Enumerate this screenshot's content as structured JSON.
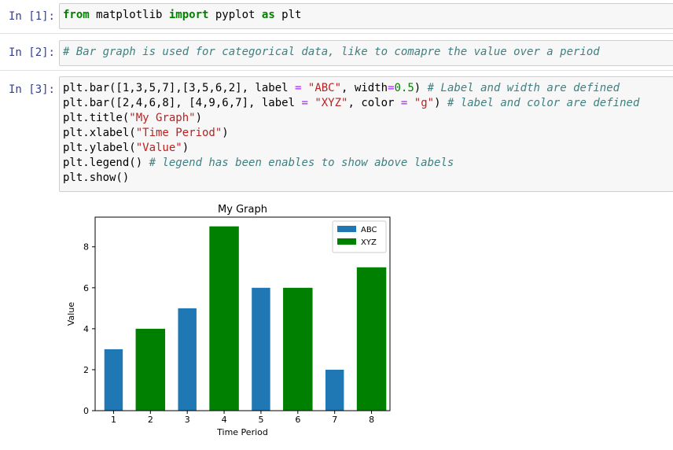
{
  "cells": [
    {
      "prompt": "In [1]:",
      "tokens": [
        [
          {
            "t": "from",
            "c": "kw"
          },
          {
            "t": " matplotlib ",
            "c": ""
          },
          {
            "t": "import",
            "c": "kw"
          },
          {
            "t": " pyplot ",
            "c": ""
          },
          {
            "t": "as",
            "c": "kw"
          },
          {
            "t": " plt",
            "c": ""
          }
        ]
      ]
    },
    {
      "prompt": "In [2]:",
      "tokens": [
        [
          {
            "t": "# Bar graph is used for categorical data, like to comapre the value over a period",
            "c": "cmt"
          }
        ]
      ]
    },
    {
      "prompt": "In [3]:",
      "tokens": [
        [
          {
            "t": "plt.bar([1,3,5,7],[3,5,6,2], label ",
            "c": ""
          },
          {
            "t": "=",
            "c": "op"
          },
          {
            "t": " ",
            "c": ""
          },
          {
            "t": "\"ABC\"",
            "c": "str"
          },
          {
            "t": ", width",
            "c": ""
          },
          {
            "t": "=",
            "c": "op"
          },
          {
            "t": "0.5",
            "c": "num"
          },
          {
            "t": ") ",
            "c": ""
          },
          {
            "t": "# Label and width are defined",
            "c": "cmt"
          }
        ],
        [
          {
            "t": "plt.bar([2,4,6,8], [4,9,6,7], label ",
            "c": ""
          },
          {
            "t": "=",
            "c": "op"
          },
          {
            "t": " ",
            "c": ""
          },
          {
            "t": "\"XYZ\"",
            "c": "str"
          },
          {
            "t": ", color ",
            "c": ""
          },
          {
            "t": "=",
            "c": "op"
          },
          {
            "t": " ",
            "c": ""
          },
          {
            "t": "\"g\"",
            "c": "str"
          },
          {
            "t": ") ",
            "c": ""
          },
          {
            "t": "# label and color are defined",
            "c": "cmt"
          }
        ],
        [
          {
            "t": "plt.title(",
            "c": ""
          },
          {
            "t": "\"My Graph\"",
            "c": "str"
          },
          {
            "t": ")",
            "c": ""
          }
        ],
        [
          {
            "t": "plt.xlabel(",
            "c": ""
          },
          {
            "t": "\"Time Period\"",
            "c": "str"
          },
          {
            "t": ")",
            "c": ""
          }
        ],
        [
          {
            "t": "plt.ylabel(",
            "c": ""
          },
          {
            "t": "\"Value\"",
            "c": "str"
          },
          {
            "t": ")",
            "c": ""
          }
        ],
        [
          {
            "t": "plt.legend() ",
            "c": ""
          },
          {
            "t": "# legend has been enables to show above labels",
            "c": "cmt"
          }
        ],
        [
          {
            "t": "plt.show()",
            "c": ""
          }
        ]
      ]
    }
  ],
  "chart_data": {
    "type": "bar",
    "title": "My Graph",
    "xlabel": "Time Period",
    "ylabel": "Value",
    "xlim": [
      0.5,
      8.5
    ],
    "ylim": [
      0,
      9.45
    ],
    "xticks": [
      1,
      2,
      3,
      4,
      5,
      6,
      7,
      8
    ],
    "yticks": [
      0,
      2,
      4,
      6,
      8
    ],
    "legend_position": "top-right",
    "grid": false,
    "series": [
      {
        "name": "ABC",
        "color": "#1f77b4",
        "x": [
          1,
          3,
          5,
          7
        ],
        "values": [
          3,
          5,
          6,
          2
        ],
        "width": 0.5
      },
      {
        "name": "XYZ",
        "color": "#008000",
        "x": [
          2,
          4,
          6,
          8
        ],
        "values": [
          4,
          9,
          6,
          7
        ],
        "width": 0.8
      }
    ]
  }
}
